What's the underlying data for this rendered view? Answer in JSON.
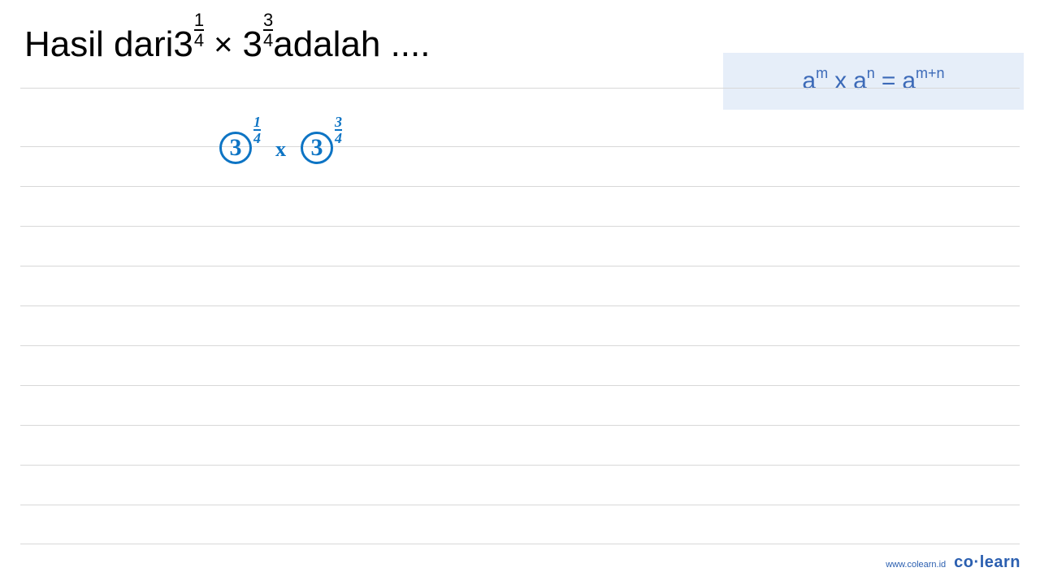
{
  "question": {
    "prefix": "Hasil dari ",
    "base1": "3",
    "exp1_num": "1",
    "exp1_den": "4",
    "mult": "×",
    "base2": "3",
    "exp2_num": "3",
    "exp2_den": "4",
    "suffix": " adalah ...."
  },
  "formula": {
    "a1": "a",
    "m": "m",
    "x": "x",
    "a2": "a",
    "n": "n",
    "eq": "=",
    "a3": "a",
    "mn": "m+n"
  },
  "handwriting": {
    "b1": "3",
    "e1n": "1",
    "e1d": "4",
    "x": "x",
    "b2": "3",
    "e2n": "3",
    "e2d": "4"
  },
  "footer": {
    "url": "www.colearn.id",
    "brand_pre": "co",
    "brand_dot": "·",
    "brand_post": "learn"
  },
  "lines": [
    108,
    180,
    229,
    278,
    327,
    376,
    425,
    474,
    523,
    572,
    621,
    669
  ]
}
